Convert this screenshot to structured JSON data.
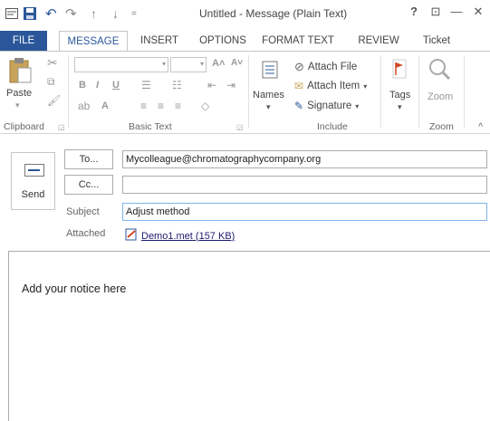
{
  "window": {
    "title": "Untitled - Message (Plain Text)",
    "help": "?",
    "restore_glyph": "⊡",
    "minimize_glyph": "—",
    "close_glyph": "✕"
  },
  "qat": {
    "icons": [
      "outlook-icon",
      "save-icon",
      "undo-icon",
      "redo-icon",
      "up-icon",
      "down-icon",
      "customize-icon"
    ]
  },
  "tabs": [
    {
      "label": "FILE"
    },
    {
      "label": "MESSAGE"
    },
    {
      "label": "INSERT"
    },
    {
      "label": "OPTIONS"
    },
    {
      "label": "FORMAT TEXT"
    },
    {
      "label": "REVIEW"
    },
    {
      "label": "Ticket"
    }
  ],
  "ribbon": {
    "clipboard": {
      "paste": "Paste",
      "group": "Clipboard"
    },
    "basic_text": {
      "group": "Basic Text",
      "bold": "B",
      "italic": "I",
      "underline": "U",
      "font_color": "A"
    },
    "names": {
      "label": "Names"
    },
    "include": {
      "attach_file": "Attach File",
      "attach_item": "Attach Item",
      "signature": "Signature",
      "group": "Include"
    },
    "tags": {
      "label": "Tags"
    },
    "zoom": {
      "label": "Zoom",
      "group": "Zoom"
    }
  },
  "compose": {
    "send": "Send",
    "to_button": "To...",
    "cc_button": "Cc...",
    "subject_label": "Subject",
    "attached_label": "Attached",
    "to_value": "Mycolleague@chromatographycompany.org",
    "cc_value": "",
    "subject_value": "Adjust method",
    "attachment": "Demo1.met (157 KB)",
    "body": "Add your notice here"
  },
  "colors": {
    "accent": "#2b579a",
    "focus_border": "#7eb4ea"
  }
}
